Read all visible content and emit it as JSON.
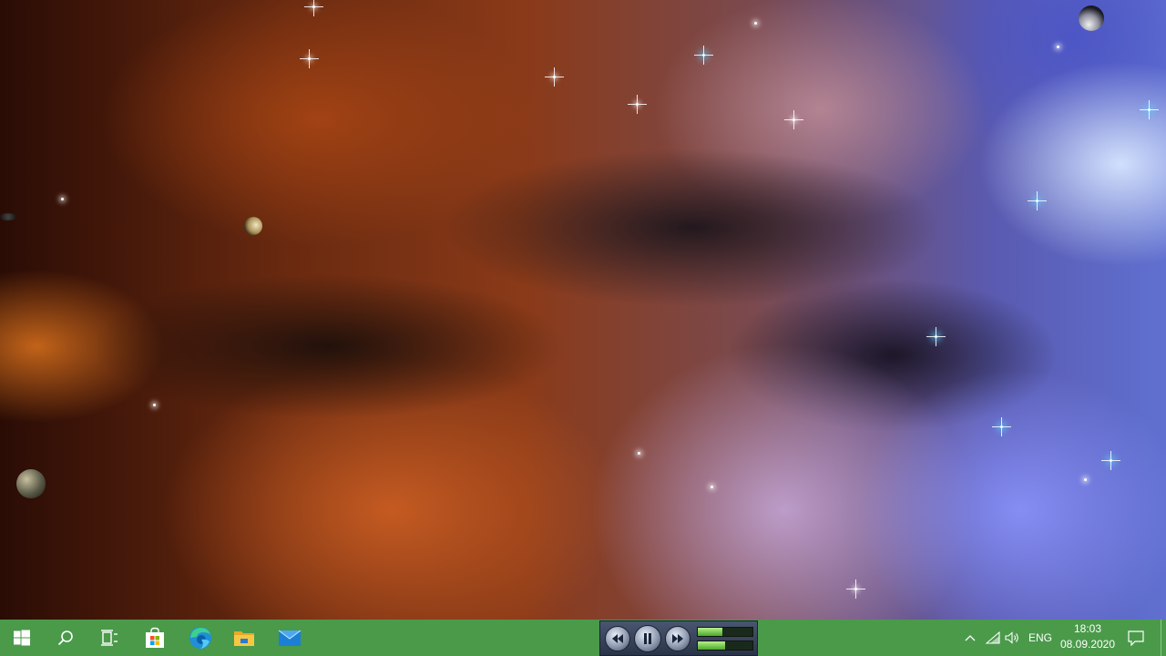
{
  "desktop": {
    "wallpaper": "nebula"
  },
  "taskbar": {
    "background_color": "#4a9a4a",
    "items": [
      {
        "name": "start-button",
        "icon": "windows-logo-icon"
      },
      {
        "name": "search-button",
        "icon": "search-icon"
      },
      {
        "name": "task-view-button",
        "icon": "task-view-icon"
      },
      {
        "name": "microsoft-store-button",
        "icon": "store-icon"
      },
      {
        "name": "edge-button",
        "icon": "edge-icon"
      },
      {
        "name": "file-explorer-button",
        "icon": "folder-icon"
      },
      {
        "name": "mail-button",
        "icon": "mail-icon"
      }
    ]
  },
  "media_player": {
    "controls": [
      "previous-icon",
      "pause-icon",
      "next-icon"
    ],
    "seek_level": 0.45,
    "volume_level": 0.5
  },
  "tray": {
    "language": "ENG",
    "time": "18:03",
    "date": "08.09.2020"
  }
}
